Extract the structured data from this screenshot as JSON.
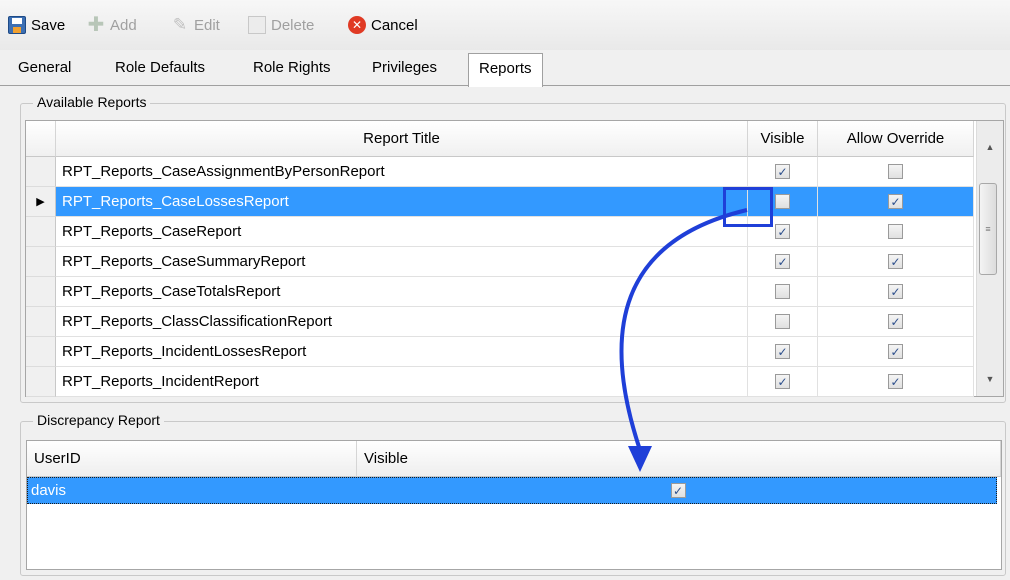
{
  "toolbar": {
    "save_label": "Save",
    "add_label": "Add",
    "edit_label": "Edit",
    "delete_label": "Delete",
    "cancel_label": "Cancel"
  },
  "tabs": [
    {
      "label": "General"
    },
    {
      "label": "Role Defaults"
    },
    {
      "label": "Role Rights"
    },
    {
      "label": "Privileges"
    },
    {
      "label": "Reports"
    }
  ],
  "active_tab": "Reports",
  "available_reports": {
    "legend": "Available Reports",
    "columns": {
      "title": "Report Title",
      "visible": "Visible",
      "override": "Allow Override"
    },
    "selected_row_indicator": "▶",
    "rows": [
      {
        "title": "RPT_Reports_CaseAssignmentByPersonReport",
        "visible": true,
        "override": false
      },
      {
        "title": "RPT_Reports_CaseLossesReport",
        "visible": false,
        "override": true,
        "selected": true
      },
      {
        "title": "RPT_Reports_CaseReport",
        "visible": true,
        "override": false
      },
      {
        "title": "RPT_Reports_CaseSummaryReport",
        "visible": true,
        "override": true
      },
      {
        "title": "RPT_Reports_CaseTotalsReport",
        "visible": false,
        "override": true
      },
      {
        "title": "RPT_Reports_ClassClassificationReport",
        "visible": false,
        "override": true
      },
      {
        "title": "RPT_Reports_IncidentLossesReport",
        "visible": true,
        "override": true
      },
      {
        "title": "RPT_Reports_IncidentReport",
        "visible": true,
        "override": true
      }
    ]
  },
  "discrepancy_report": {
    "legend": "Discrepancy Report",
    "columns": {
      "user": "UserID",
      "visible": "Visible"
    },
    "rows": [
      {
        "user": "davis",
        "visible": true
      }
    ]
  },
  "colors": {
    "selection": "#3399ff",
    "annotation": "#1f3fd8"
  },
  "icons": {
    "save": "save-icon",
    "add": "add-icon",
    "edit": "edit-icon",
    "delete": "delete-icon",
    "cancel": "cancel-icon"
  }
}
